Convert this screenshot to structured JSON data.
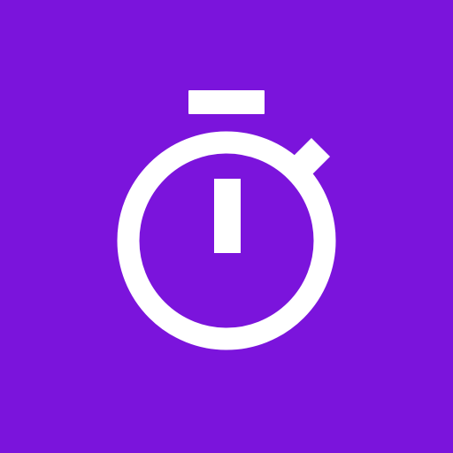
{
  "app_icon": {
    "name": "stopwatch-icon",
    "background_color": "#7B14DC",
    "foreground_color": "#FFFFFF"
  }
}
